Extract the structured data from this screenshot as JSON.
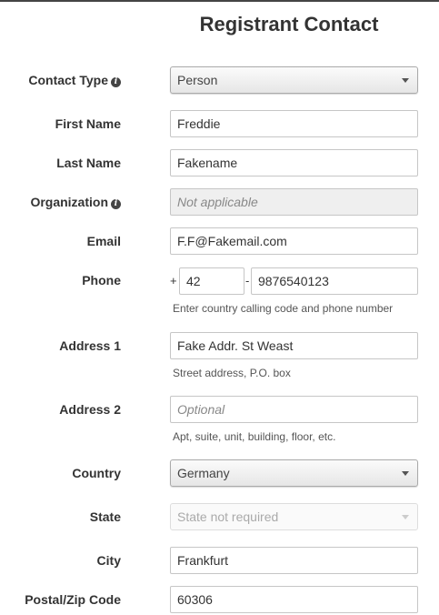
{
  "page": {
    "title": "Registrant Contact"
  },
  "form": {
    "contact_type": {
      "label": "Contact Type",
      "value": "Person"
    },
    "first_name": {
      "label": "First Name",
      "value": "Freddie"
    },
    "last_name": {
      "label": "Last Name",
      "value": "Fakename"
    },
    "organization": {
      "label": "Organization",
      "placeholder": "Not applicable"
    },
    "email": {
      "label": "Email",
      "value": "F.F@Fakemail.com"
    },
    "phone": {
      "label": "Phone",
      "plus": "+",
      "separator": "-",
      "country_code": "42",
      "number": "9876540123",
      "help": "Enter country calling code and phone number"
    },
    "address1": {
      "label": "Address 1",
      "value": "Fake Addr. St Weast",
      "help": "Street address, P.O. box"
    },
    "address2": {
      "label": "Address 2",
      "placeholder": "Optional",
      "help": "Apt, suite, unit, building, floor, etc."
    },
    "country": {
      "label": "Country",
      "value": "Germany"
    },
    "state": {
      "label": "State",
      "value": "State not required"
    },
    "city": {
      "label": "City",
      "value": "Frankfurt"
    },
    "postal": {
      "label": "Postal/Zip Code",
      "value": "60306"
    }
  },
  "icons": {
    "info": "info-circle-icon",
    "dropdown": "chevron-down-icon"
  }
}
